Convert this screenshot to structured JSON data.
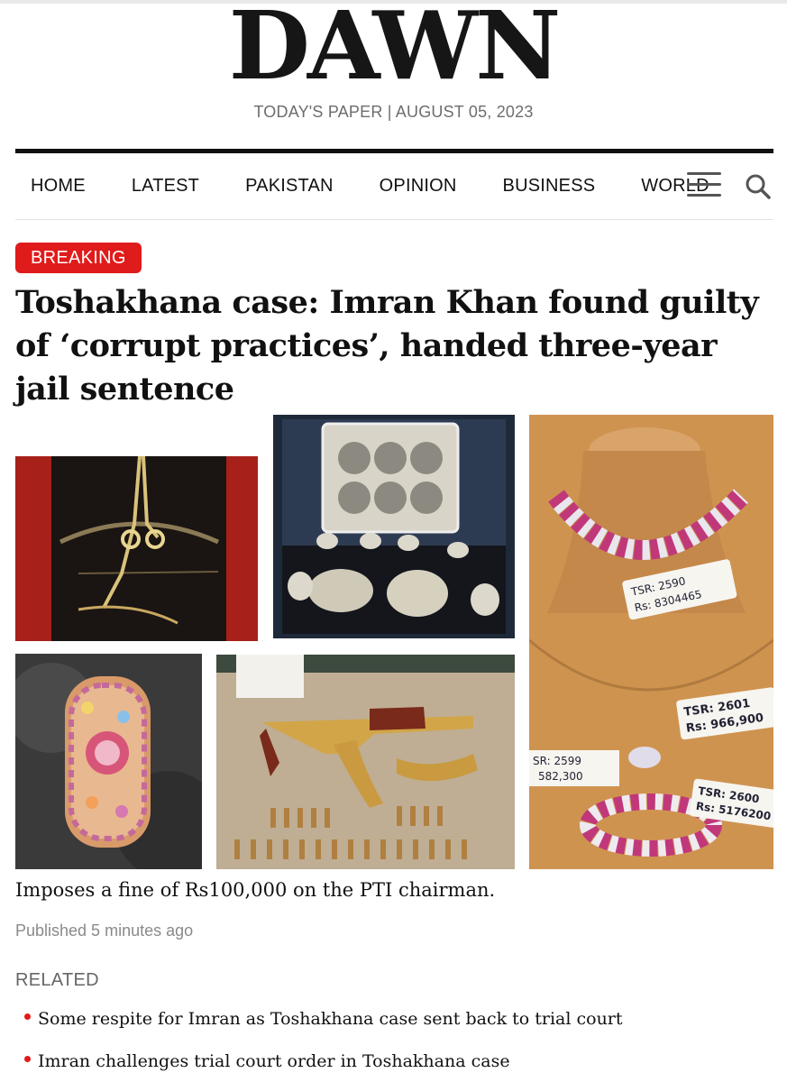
{
  "masthead": {
    "logo": "DAWN",
    "todays_paper": "TODAY'S PAPER | AUGUST 05, 2023"
  },
  "nav": {
    "items": [
      "HOME",
      "LATEST",
      "PAKISTAN",
      "OPINION",
      "BUSINESS",
      "WORLD"
    ],
    "menu_icon": "hamburger-menu-icon",
    "search_icon": "search-icon"
  },
  "article": {
    "badge": "BREAKING",
    "headline": "Toshakhana case: Imran Khan found guilty of ‘corrupt practices’, handed three-year jail sentence",
    "caption": "Imposes a fine of Rs100,000 on the PTI chairman.",
    "published": "Published 5 minutes ago"
  },
  "photo_tags": {
    "tag1_line1": "TSR: 2590",
    "tag1_line2": "Rs: 8304465",
    "tag2_line1": "TSR: 2601",
    "tag2_line2": "Rs: 966,900",
    "tag3_line1": "SR: 2599",
    "tag3_line2": "582,300",
    "tag4_line1": "TSR: 2600",
    "tag4_line2": "Rs: 5176200"
  },
  "related": {
    "label": "RELATED",
    "items": [
      "Some respite for Imran as Toshakhana case sent back to trial court",
      "Imran challenges trial court order in Toshakhana case"
    ]
  },
  "colors": {
    "accent_red": "#e01b1b",
    "text": "#111111",
    "muted": "#8a8a8a"
  }
}
